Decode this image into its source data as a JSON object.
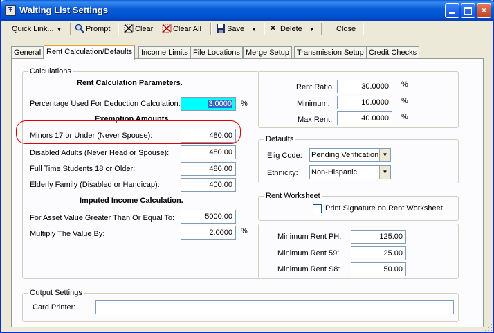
{
  "window": {
    "title": "Waiting List Settings",
    "app_icon_glyph": "Ŧ"
  },
  "toolbar": {
    "quick_link": "Quick Link...",
    "prompt": "Prompt",
    "clear": "Clear",
    "clear_all": "Clear All",
    "save": "Save",
    "delete": "Delete",
    "close": "Close"
  },
  "tabs": [
    "General",
    "Rent Calculation/Defaults",
    "Income Limits",
    "File Locations",
    "Merge Setup",
    "Transmission Setup",
    "Credit Checks"
  ],
  "calculations": {
    "legend": "Calculations",
    "heading": "Rent Calculation Parameters.",
    "deduction_label": "Percentage Used For Deduction Calculation:",
    "deduction_value": "3.0000",
    "deduction_unit": "%",
    "exemption_heading": "Exemption Amounts.",
    "minors_label": "Minors 17 or Under (Never Spouse):",
    "minors_value": "480.00",
    "disabled_label": "Disabled Adults (Never Head or Spouse):",
    "disabled_value": "480.00",
    "students_label": "Full Time Students 18 or Older:",
    "students_value": "480.00",
    "elderly_label": "Elderly Family (Disabled or Handicap):",
    "elderly_value": "400.00",
    "imputed_heading": "Imputed Income Calculation.",
    "asset_label": "For Asset Value Greater Than Or Equal To:",
    "asset_value": "5000.00",
    "multiply_label": "Multiply The Value By:",
    "multiply_value": "2.0000",
    "multiply_unit": "%"
  },
  "rent": {
    "ratio_label": "Rent Ratio:",
    "ratio_value": "30.0000",
    "ratio_unit": "%",
    "minimum_label": "Minimum:",
    "minimum_value": "10.0000",
    "minimum_unit": "%",
    "max_label": "Max Rent:",
    "max_value": "40.0000",
    "max_unit": "%"
  },
  "defaults": {
    "legend": "Defaults",
    "elig_label": "Elig Code:",
    "elig_value": "Pending Verification",
    "ethnicity_label": "Ethnicity:",
    "ethnicity_value": "Non-Hispanic"
  },
  "worksheet": {
    "legend": "Rent Worksheet",
    "print_signature_label": "Print Signature on Rent Worksheet",
    "print_signature_checked": false
  },
  "minrent": {
    "ph_label": "Minimum Rent PH:",
    "ph_value": "125.00",
    "r59_label": "Minimum Rent 59:",
    "r59_value": "25.00",
    "s8_label": "Minimum Rent S8:",
    "s8_value": "50.00"
  },
  "output": {
    "legend": "Output Settings",
    "card_printer_label": "Card Printer:",
    "card_printer_value": ""
  },
  "colors": {
    "highlight_field": "#00ffff",
    "annotation_oval": "#e00000",
    "title_bar": "#0a5fd8"
  }
}
